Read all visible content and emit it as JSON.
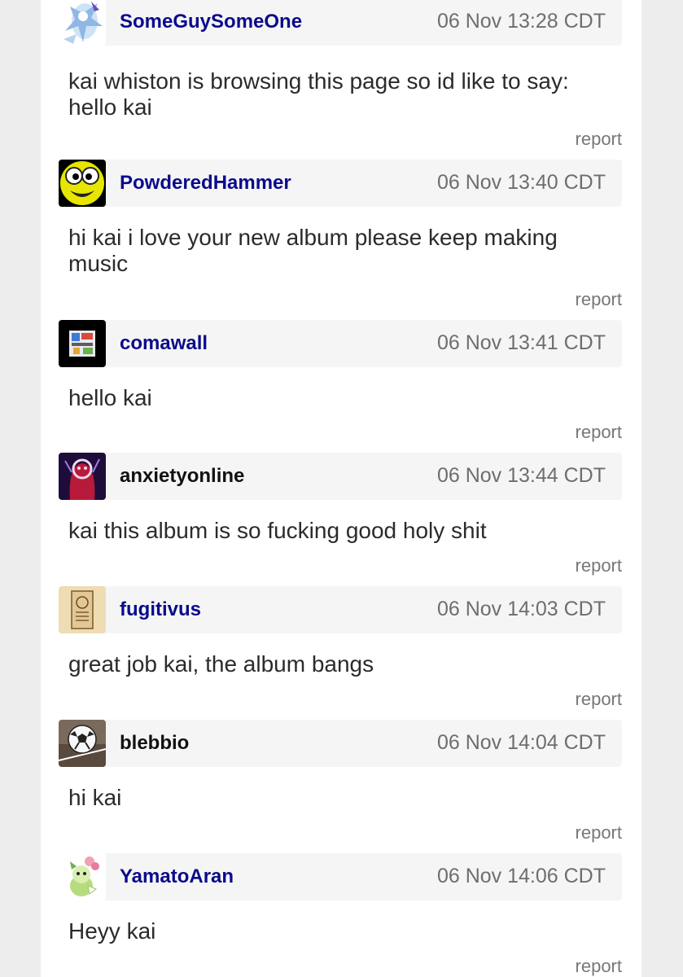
{
  "comments": [
    {
      "username": "SomeGuySomeOne",
      "timestamp": "06 Nov 13:28 CDT",
      "body": "kai whiston is browsing this page so id like to say: hello kai",
      "report": "report"
    },
    {
      "username": "PowderedHammer",
      "timestamp": "06 Nov 13:40 CDT",
      "body": "hi kai i love your new album please keep making music",
      "report": "report"
    },
    {
      "username": "comawall",
      "timestamp": "06 Nov 13:41 CDT",
      "body": "hello kai",
      "report": "report"
    },
    {
      "username": "anxietyonline",
      "timestamp": "06 Nov 13:44 CDT",
      "body": "kai this album is so fucking good holy shit",
      "report": "report"
    },
    {
      "username": "fugitivus",
      "timestamp": "06 Nov 14:03 CDT",
      "body": "great job kai, the album bangs",
      "report": "report"
    },
    {
      "username": "blebbio",
      "timestamp": "06 Nov 14:04 CDT",
      "body": "hi kai",
      "report": "report"
    },
    {
      "username": "YamatoAran",
      "timestamp": "06 Nov 14:06 CDT",
      "body": "Heyy kai",
      "report": "report"
    }
  ],
  "colors": {
    "username_link": "#0b0b8c",
    "username_plain": "#111111",
    "timestamp": "#6e6e6e",
    "header_bg": "#f5f5f5",
    "page_bg": "#ededed"
  }
}
